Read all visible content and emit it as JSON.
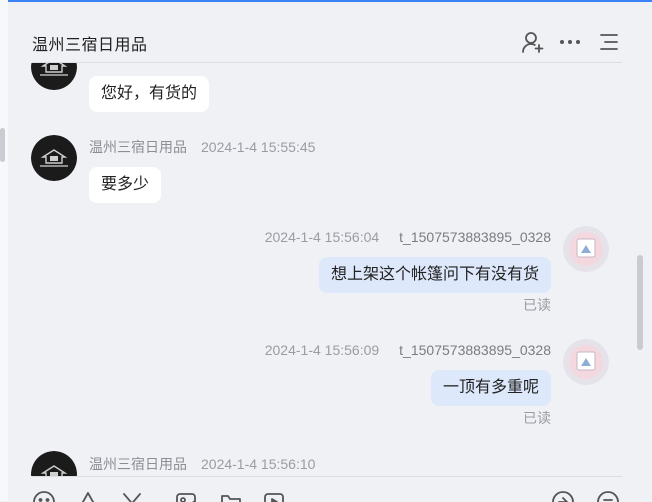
{
  "header": {
    "title": "温州三宿日用品",
    "icons": [
      "add-user-icon",
      "more-icon",
      "menu-icon"
    ]
  },
  "messages": [
    {
      "from": "shop",
      "text": "您好，有货的"
    },
    {
      "from": "shop",
      "sender": "温州三宿日用品",
      "time": "2024-1-4 15:55:45",
      "text": "要多少"
    },
    {
      "from": "customer",
      "sender": "t_1507573883895_0328",
      "time": "2024-1-4 15:56:04",
      "text": "想上架这个帐篷问下有没有货",
      "status": "已读"
    },
    {
      "from": "customer",
      "sender": "t_1507573883895_0328",
      "time": "2024-1-4 15:56:09",
      "text": "一顶有多重呢",
      "status": "已读"
    },
    {
      "from": "shop",
      "sender": "温州三宿日用品",
      "time": "2024-1-4 15:56:10"
    }
  ],
  "toolbar": {
    "icons": [
      "emoji-icon",
      "shape-icon",
      "scissors-icon",
      "image-icon",
      "folder-icon",
      "video-icon",
      "send-icon",
      "list-icon"
    ]
  },
  "colors": {
    "accent": "#3b82f6",
    "outgoing_bubble": "#dde8fb",
    "incoming_bubble": "#ffffff",
    "background": "#f0f1f5"
  }
}
